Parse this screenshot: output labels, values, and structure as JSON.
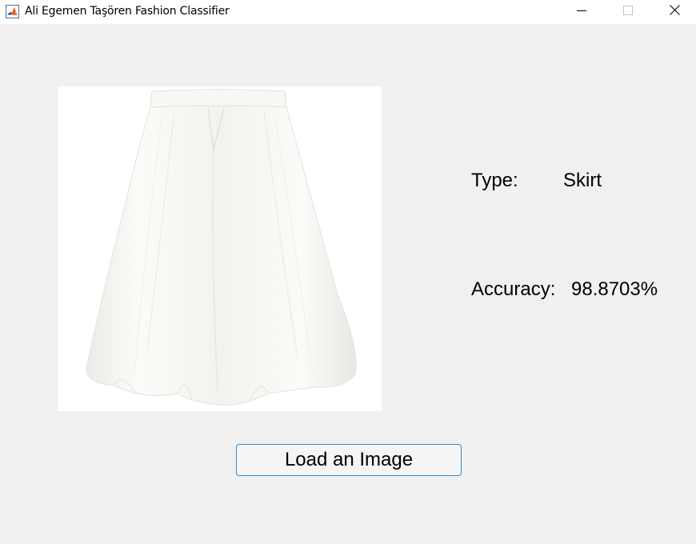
{
  "window": {
    "title": "Ali Egemen Taşören Fashion Classifier",
    "icon": "matlab-icon",
    "controls": [
      "minimize-icon",
      "maximize-icon",
      "close-icon"
    ]
  },
  "result": {
    "type_label": "Type:",
    "type_value": "Skirt",
    "accuracy_label": "Accuracy:",
    "accuracy_value": "98.8703%"
  },
  "image_panel": {
    "content": "white-pleated-skirt-photo"
  },
  "actions": {
    "load_button_label": "Load an Image"
  },
  "colors": {
    "background": "#f0f0f0",
    "titlebar": "#ffffff",
    "button_border": "#2d8fd5",
    "button_fill": "#f5f5f5"
  }
}
